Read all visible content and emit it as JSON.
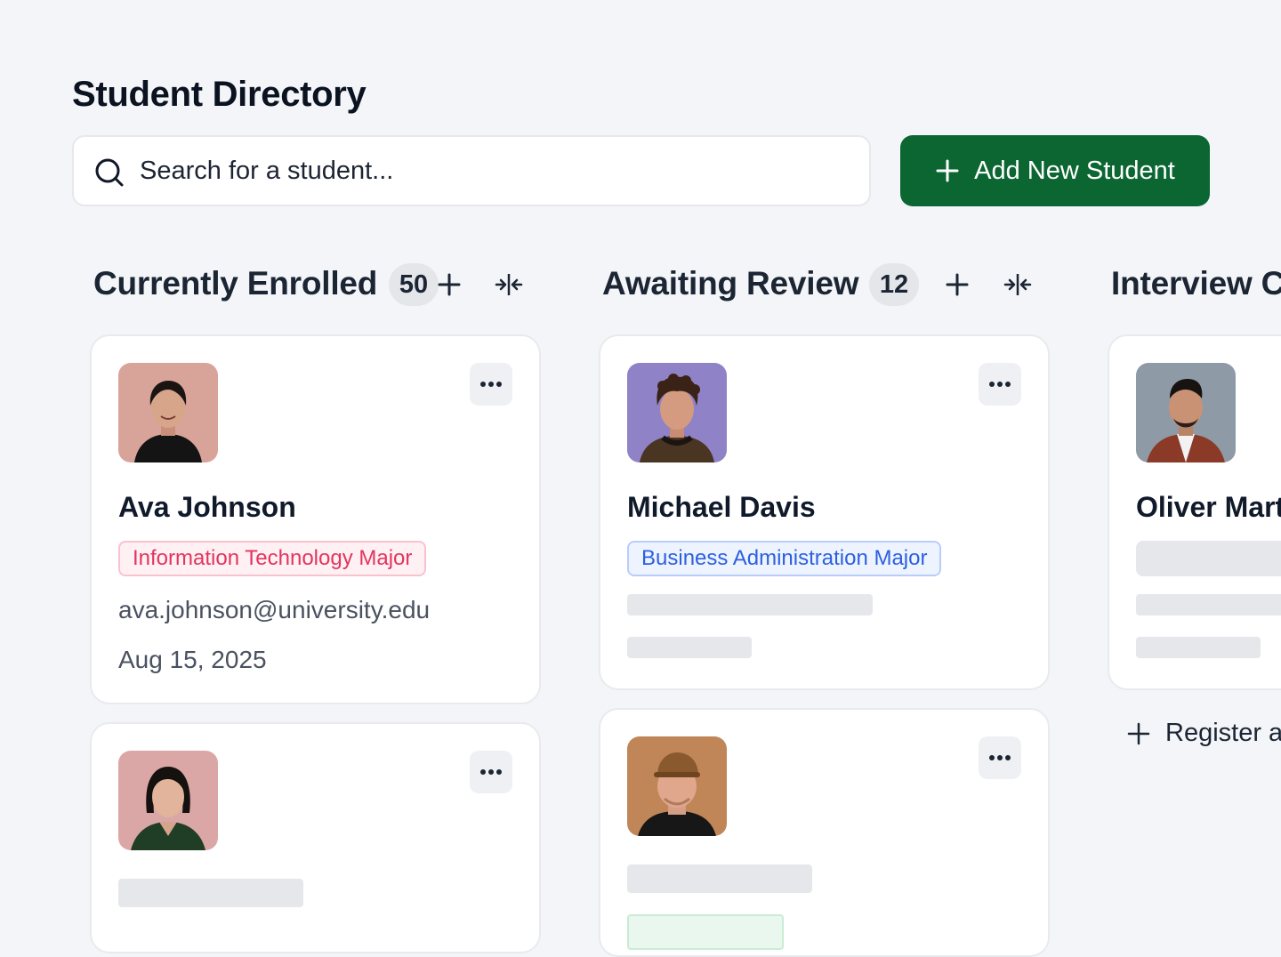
{
  "header": {
    "title": "Student Directory"
  },
  "search": {
    "placeholder": "Search for a student..."
  },
  "actions": {
    "add_label": "Add New Student"
  },
  "columns": [
    {
      "title": "Currently Enrolled",
      "count": "50",
      "cards": [
        {
          "name": "Ava Johnson",
          "major": "Information Technology Major",
          "major_color": "#e2355f",
          "email": "ava.johnson@university.edu",
          "date": "Aug 15, 2025"
        },
        {
          "name": "",
          "major": "",
          "email": "",
          "date": ""
        }
      ]
    },
    {
      "title": "Awaiting Review",
      "count": "12",
      "cards": [
        {
          "name": "Michael Davis",
          "major": "Business Administration Major",
          "major_color": "#2d5fe0"
        },
        {
          "name": ""
        }
      ]
    },
    {
      "title": "Interview C",
      "cards": [
        {
          "name": "Oliver Mart"
        }
      ],
      "register_label": "Register a"
    }
  ],
  "colors": {
    "accent": "#0b6632",
    "background": "#f3f5f8",
    "skeleton": "#e5e7eb"
  },
  "icons": [
    "search-icon",
    "plus-icon",
    "collapse-icon",
    "more-icon"
  ]
}
